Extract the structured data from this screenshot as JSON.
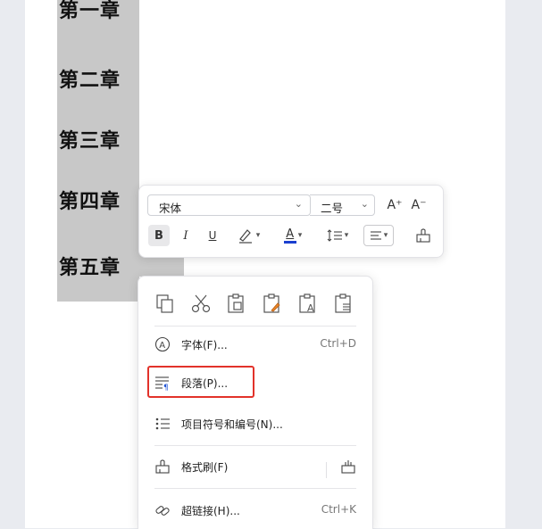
{
  "document": {
    "headings": [
      "第一章",
      "第二章",
      "第三章",
      "第四章",
      "第五章"
    ]
  },
  "mini_toolbar": {
    "font_name": "宋体",
    "font_size": "二号",
    "grow_font": "A⁺",
    "shrink_font": "A⁻",
    "bold": "B",
    "italic": "I",
    "underline": "U",
    "font_color_letter": "A",
    "font_color": "#1a3fcf"
  },
  "context_menu": {
    "items": [
      {
        "label": "字体(F)...",
        "shortcut": "Ctrl+D"
      },
      {
        "label": "段落(P)..."
      },
      {
        "label": "项目符号和编号(N)..."
      },
      {
        "label": "格式刷(F)"
      },
      {
        "label": "超链接(H)...",
        "shortcut": "Ctrl+K"
      }
    ]
  },
  "colors": {
    "highlight_box": "#e2322a",
    "selection": "#c8c8c8"
  }
}
